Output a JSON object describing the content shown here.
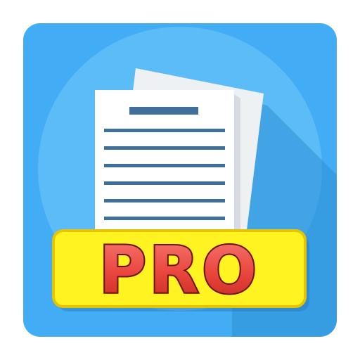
{
  "icon": {
    "badge_text": "PRO",
    "colors": {
      "tile": "#42adf4",
      "tile_shadow": "#2f8fd6",
      "circle": "#5bbcf8",
      "page": "#ffffff",
      "page_back": "#f0f2f4",
      "lines": "#3f6f9a",
      "badge_fill": "#fff321",
      "badge_stroke": "#e8c400",
      "text_fill": "#e8453c",
      "text_stroke": "#6e0f0b"
    },
    "icons": [
      "document-icon"
    ]
  }
}
